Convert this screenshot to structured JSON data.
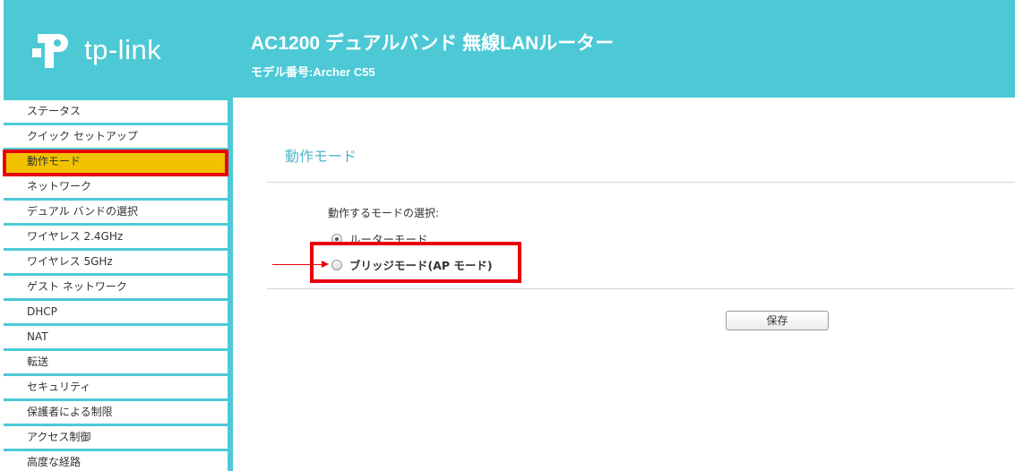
{
  "header": {
    "logo_text": "tp-link",
    "product_title": "AC1200 デュアルバンド 無線LANルーター",
    "model_line": "モデル番号:Archer C55"
  },
  "sidebar": {
    "items": [
      {
        "label": "ステータス"
      },
      {
        "label": "クイック セットアップ"
      },
      {
        "label": "動作モード"
      },
      {
        "label": "ネットワーク"
      },
      {
        "label": "デュアル バンドの選択"
      },
      {
        "label": "ワイヤレス 2.4GHz"
      },
      {
        "label": "ワイヤレス 5GHz"
      },
      {
        "label": "ゲスト ネットワーク"
      },
      {
        "label": "DHCP"
      },
      {
        "label": "NAT"
      },
      {
        "label": "転送"
      },
      {
        "label": "セキュリティ"
      },
      {
        "label": "保護者による制限"
      },
      {
        "label": "アクセス制御"
      },
      {
        "label": "高度な経路"
      }
    ]
  },
  "main": {
    "section_title": "動作モード",
    "mode_select_label": "動作するモードの選択:",
    "options": [
      {
        "label": "ルーターモード",
        "checked": true
      },
      {
        "label": "ブリッジモード(AP モード)",
        "checked": false
      }
    ],
    "save_label": "保存"
  },
  "colors": {
    "brand": "#4dc9d6",
    "highlight": "#e8000b",
    "active_item": "#f2c200"
  }
}
